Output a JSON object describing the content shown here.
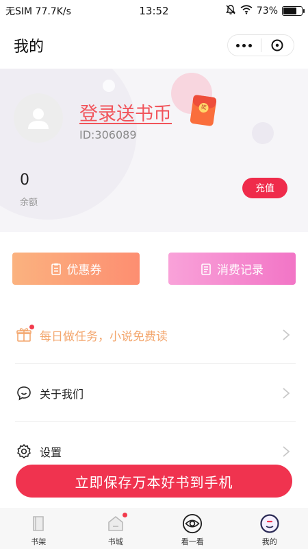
{
  "status_bar": {
    "carrier": "无SIM 77.7K/s",
    "time": "13:52",
    "battery": "73%",
    "battery_level": 0.73
  },
  "header": {
    "title": "我的"
  },
  "profile": {
    "login_text": "登录送书币",
    "user_id": "ID:306089",
    "redpack_char": "奖"
  },
  "balance": {
    "value": "0",
    "label": "余额",
    "recharge": "充值"
  },
  "actions": {
    "coupon": "优惠券",
    "records": "消费记录"
  },
  "menu": {
    "task": "每日做任务，小说免费读",
    "about": "关于我们",
    "settings": "设置"
  },
  "banner": {
    "save": "立即保存万本好书到手机"
  },
  "tabs": [
    {
      "label": "书架"
    },
    {
      "label": "书城"
    },
    {
      "label": "看一看"
    },
    {
      "label": "我的"
    }
  ],
  "colors": {
    "accent": "#ef2b4b",
    "login": "#f1535a",
    "task": "#f3a66d"
  }
}
